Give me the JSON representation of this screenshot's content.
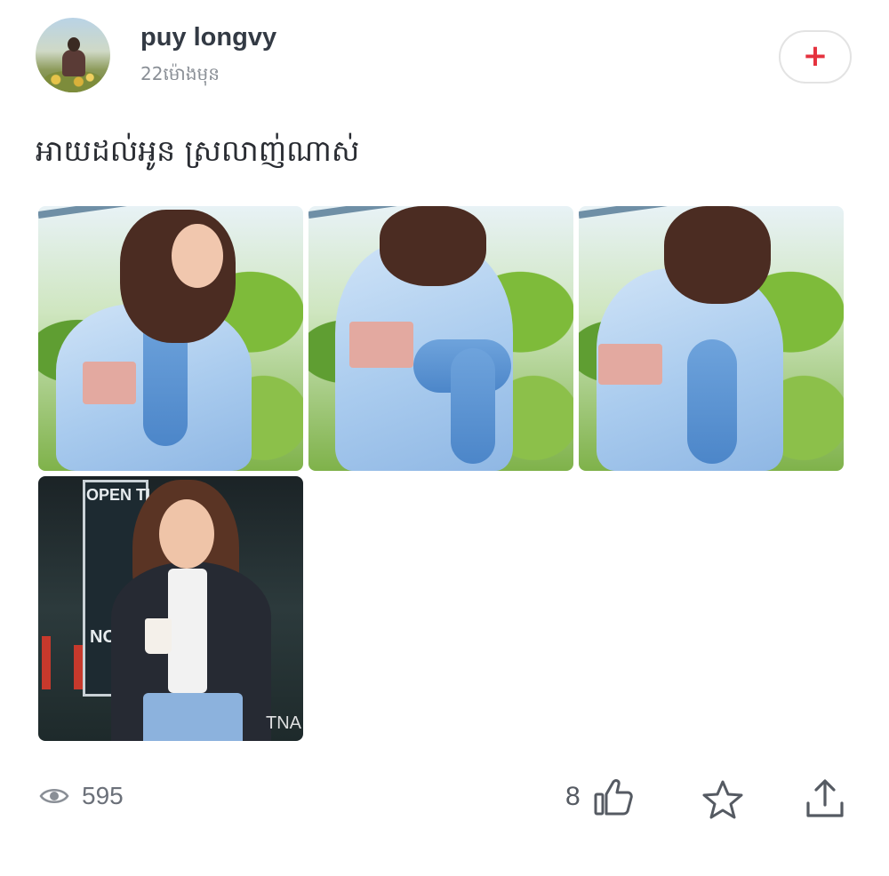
{
  "post": {
    "author": {
      "name": "puy longvy",
      "time_ago": "22ម៉ោងមុន"
    },
    "follow_button": {
      "icon": "plus-icon",
      "symbol": "+",
      "color": "#e5323e"
    },
    "text": "អាយដល់អូន ស្រលាញ់ណាស់",
    "photos": {
      "count": 4,
      "indoor_sign_top": "OPEN TI",
      "indoor_sign_bottom": "NO PET",
      "watermark": "TNA"
    },
    "stats": {
      "views_icon": "eye-icon",
      "views": "595",
      "likes": "8",
      "like_icon": "thumbs-up-icon",
      "favorite_icon": "star-icon",
      "share_icon": "share-icon"
    }
  }
}
